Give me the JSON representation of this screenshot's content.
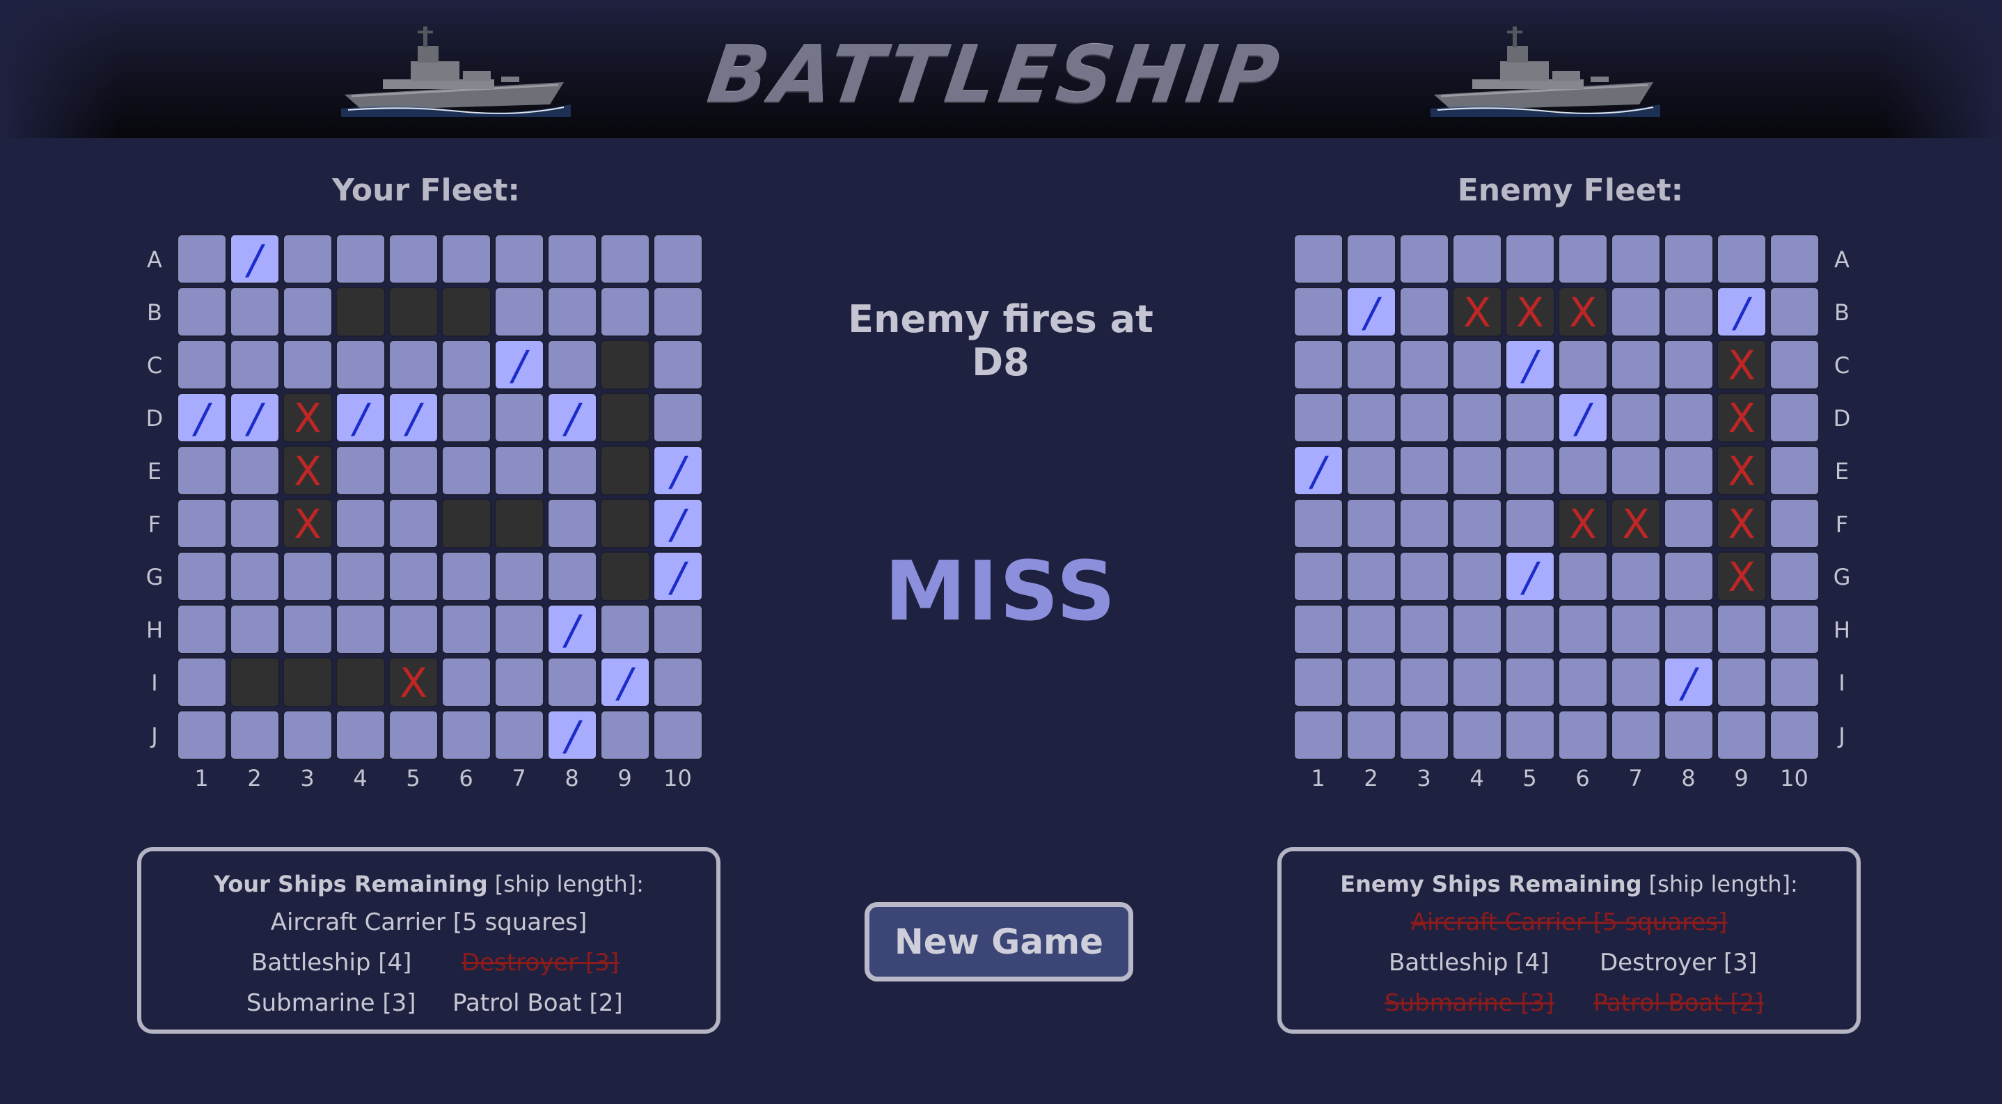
{
  "header": {
    "logo_text": "BATTLESHIP"
  },
  "your_fleet": {
    "title": "Your Fleet:",
    "board": [
      "_/________",
      "___SSS____",
      "______/_S_",
      "//X//__/S_",
      "__X_____S/",
      "__X__SS_S/",
      "________S/",
      "_______/__",
      "_SSSX___/_",
      "_______/__"
    ]
  },
  "enemy_fleet": {
    "title": "Enemy Fleet:",
    "board": [
      "__________",
      "_/_XXX__/_",
      "____/___X_",
      "_____/__X_",
      "/_______X_",
      "_____XX_X_",
      "____/___X_",
      "__________",
      "_______/__",
      "__________"
    ]
  },
  "row_labels": [
    "A",
    "B",
    "C",
    "D",
    "E",
    "F",
    "G",
    "H",
    "I",
    "J"
  ],
  "col_labels": [
    "1",
    "2",
    "3",
    "4",
    "5",
    "6",
    "7",
    "8",
    "9",
    "10"
  ],
  "legend_marks": {
    "miss": "/",
    "hit": "X"
  },
  "status": {
    "line1": "Enemy fires at",
    "line2": "D8",
    "result": "MISS"
  },
  "new_game_label": "New Game",
  "your_ships": {
    "title_bold": "Your Ships Remaining",
    "title_rest": " [ship length]:",
    "items": [
      {
        "label": "Aircraft Carrier [5 squares]",
        "sunk": false
      },
      {
        "label": "Battleship [4]",
        "sunk": false
      },
      {
        "label": "Destroyer [3]",
        "sunk": true
      },
      {
        "label": "Submarine [3]",
        "sunk": false
      },
      {
        "label": "Patrol Boat [2]",
        "sunk": false
      }
    ]
  },
  "enemy_ships": {
    "title_bold": "Enemy Ships Remaining",
    "title_rest": " [ship length]:",
    "items": [
      {
        "label": "Aircraft Carrier [5 squares]",
        "sunk": true
      },
      {
        "label": "Battleship [4]",
        "sunk": false
      },
      {
        "label": "Destroyer [3]",
        "sunk": false
      },
      {
        "label": "Submarine [3]",
        "sunk": true
      },
      {
        "label": "Patrol Boat [2]",
        "sunk": true
      }
    ]
  },
  "colors": {
    "background": "#1f2140",
    "cell_water": "#8a8ec2",
    "cell_ship": "#303030",
    "cell_miss": "#a8acff",
    "miss_mark": "#1b2cc9",
    "hit_mark": "#bf2626",
    "sunk_text": "#8b1c1c",
    "result_text": "#8c90dc"
  }
}
